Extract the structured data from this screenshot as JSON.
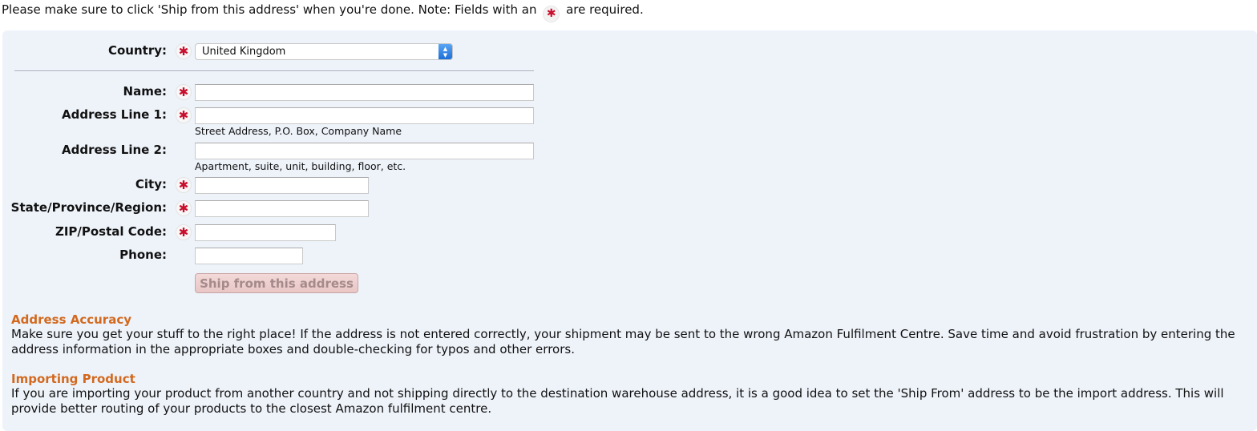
{
  "top_note": {
    "before": "Please make sure to click 'Ship from this address' when you're done. Note: Fields with an",
    "after": "are required."
  },
  "required_symbol": "✱",
  "form": {
    "country_label": "Country:",
    "country_value": "United Kingdom",
    "name_label": "Name:",
    "address1_label": "Address Line 1:",
    "address1_hint": "Street Address, P.O. Box, Company Name",
    "address2_label": "Address Line 2:",
    "address2_hint": "Apartment, suite, unit, building, floor, etc.",
    "city_label": "City:",
    "state_label": "State/Province/Region:",
    "zip_label": "ZIP/Postal Code:",
    "phone_label": "Phone:",
    "submit_label": "Ship from this address"
  },
  "sections": {
    "accuracy_title": "Address Accuracy",
    "accuracy_body": "Make sure you get your stuff to the right place! If the address is not entered correctly, your shipment may be sent to the wrong Amazon Fulfilment Centre. Save time and avoid frustration by entering the address information in the appropriate boxes and double-checking for typos and other errors.",
    "importing_title": "Importing Product",
    "importing_body": "If you are importing your product from another country and not shipping directly to the destination warehouse address, it is a good idea to set the 'Ship From' address to be the import address. This will provide better routing of your products to the closest Amazon fulfilment centre."
  },
  "colors": {
    "panel_bg": "#eef3fa",
    "required_red": "#c8102e",
    "section_title": "#d2691e",
    "select_accent": "#1c6fd8"
  },
  "icons": {
    "required": "required-asterisk-icon",
    "select_arrows": "select-up-down-icon"
  }
}
